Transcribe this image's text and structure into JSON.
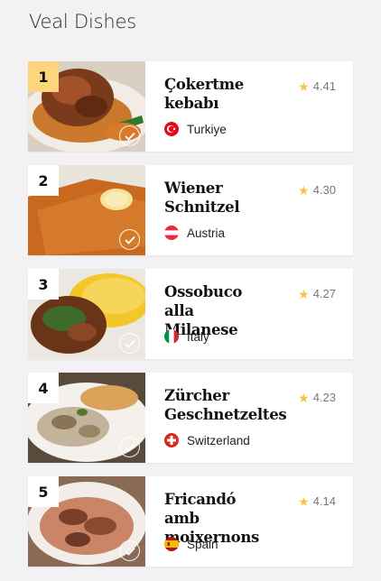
{
  "page": {
    "title": "Veal Dishes"
  },
  "dishes": [
    {
      "rank": "1",
      "name": "Çokertme kebabı",
      "rating": "4.41",
      "country": "Turkiye",
      "flag_icon": "turkey-flag-icon"
    },
    {
      "rank": "2",
      "name": "Wiener Schnitzel",
      "rating": "4.30",
      "country": "Austria",
      "flag_icon": "austria-flag-icon"
    },
    {
      "rank": "3",
      "name": "Ossobuco alla Milanese",
      "rating": "4.27",
      "country": "Italy",
      "flag_icon": "italy-flag-icon"
    },
    {
      "rank": "4",
      "name": "Zürcher Geschnetzeltes",
      "rating": "4.23",
      "country": "Switzerland",
      "flag_icon": "switzerland-flag-icon"
    },
    {
      "rank": "5",
      "name": "Fricandó amb moixernons",
      "rating": "4.14",
      "country": "Spain",
      "flag_icon": "spain-flag-icon"
    }
  ],
  "colors": {
    "rank_highlight": "#fdd57c",
    "star": "#f5c542",
    "background": "#f2f2f4"
  }
}
